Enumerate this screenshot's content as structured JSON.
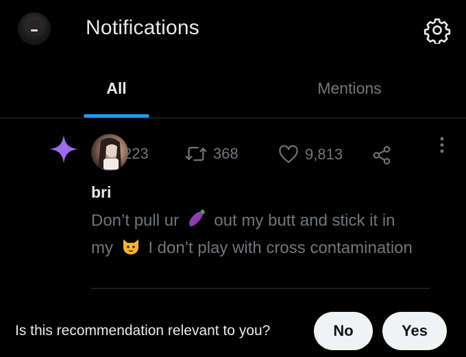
{
  "header": {
    "title": "Notifications",
    "settings_icon": "gear-icon"
  },
  "tabs": [
    {
      "label": "All",
      "active": true
    },
    {
      "label": "Mentions",
      "active": false
    }
  ],
  "colors": {
    "accent": "#1d9bf0",
    "sparkle": "#9b6cf0",
    "text": "#e7e9ea",
    "muted": "#71767b",
    "background": "#000000"
  },
  "notification": {
    "icon": "sparkle-icon",
    "stats": {
      "replies": "223",
      "retweets": "368",
      "likes": "9,813"
    },
    "user_name": "bri",
    "tweet": {
      "part1": "Don’t pull ur",
      "emoji1": "eggplant-emoji",
      "part2": "out my butt and stick it in my",
      "emoji2": "cat-emoji",
      "part3": "I don’t play with cross contamination"
    }
  },
  "prompt": {
    "question": "Is this recommendation relevant to you?",
    "no_label": "No",
    "yes_label": "Yes"
  }
}
